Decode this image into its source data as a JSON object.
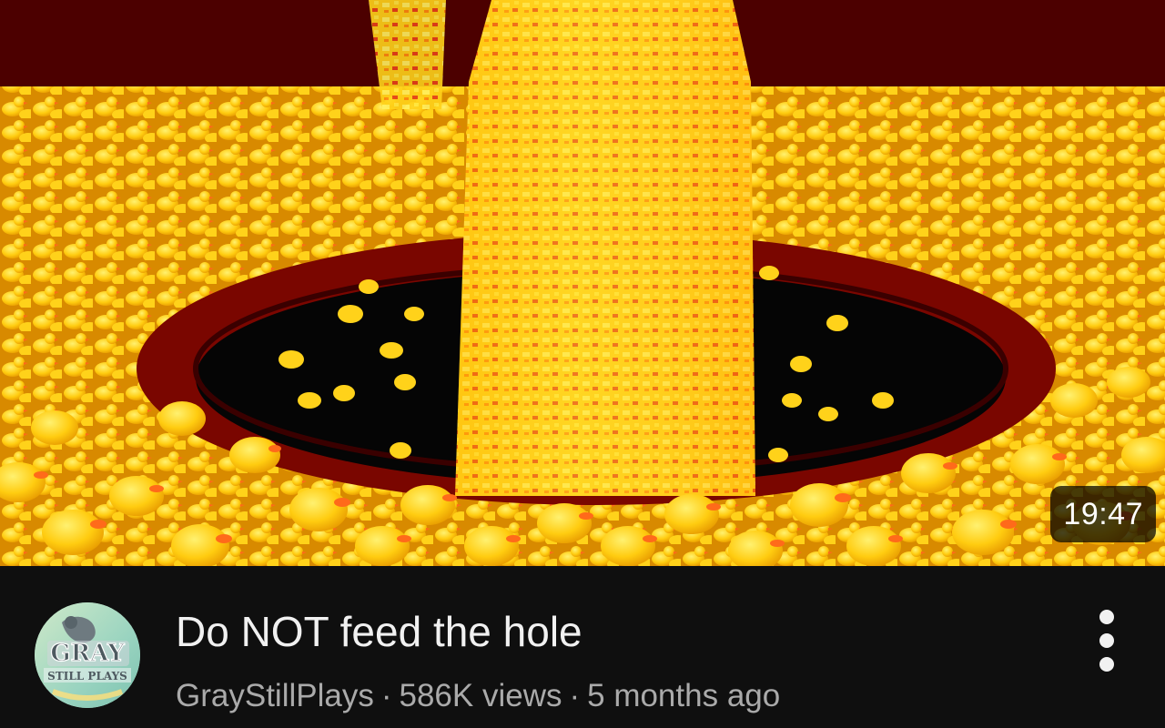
{
  "video": {
    "title": "Do NOT feed the hole",
    "duration": "19:47",
    "channel": "GrayStillPlays",
    "views": "586K views",
    "age": "5 months ago",
    "separator": "·"
  },
  "avatar": {
    "text_top": "GRAY",
    "text_bottom": "STILL PLAYS"
  },
  "icons": {
    "more": "more-vertical-icon"
  },
  "colors": {
    "background": "#0f0f0f",
    "title": "#f1f1f1",
    "meta": "#aaaaaa",
    "thumbnail_bg": "#5a0000",
    "duck": "#ffd21a",
    "beak": "#ff6a1a"
  }
}
